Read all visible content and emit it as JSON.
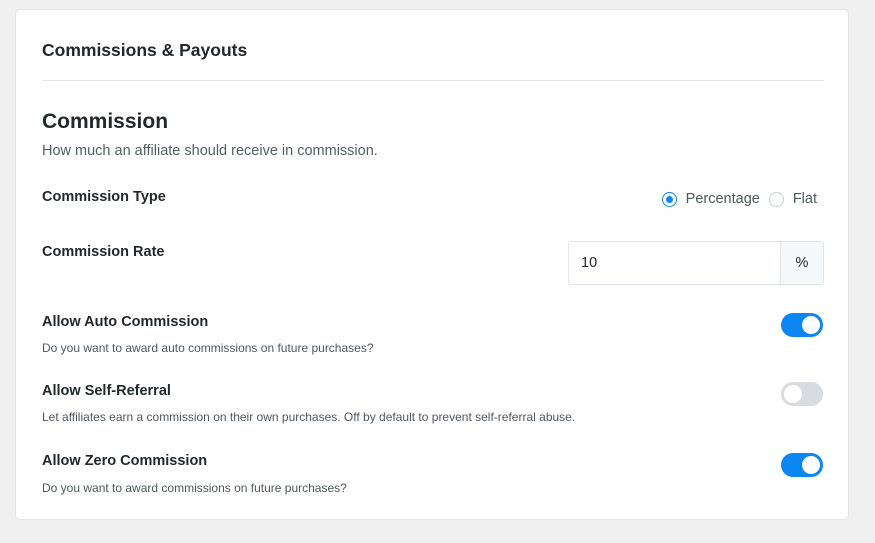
{
  "card": {
    "title": "Commissions & Payouts"
  },
  "commission": {
    "title": "Commission",
    "description": "How much an affiliate should receive in commission.",
    "type": {
      "label": "Commission Type",
      "options": [
        {
          "label": "Percentage",
          "selected": true
        },
        {
          "label": "Flat",
          "selected": false
        }
      ]
    },
    "rate": {
      "label": "Commission Rate",
      "value": "10",
      "suffix": "%"
    },
    "toggles": [
      {
        "label": "Allow Auto Commission",
        "help": "Do you want to award auto commissions on future purchases?",
        "enabled": true
      },
      {
        "label": "Allow Self-Referral",
        "help": "Let affiliates earn a commission on their own purchases. Off by default to prevent self-referral abuse.",
        "enabled": false
      },
      {
        "label": "Allow Zero Commission",
        "help": "Do you want to award commissions on future purchases?",
        "enabled": true
      }
    ]
  },
  "colors": {
    "accent": "#0b86f2",
    "toggle_off": "#d8dbe0",
    "page_background": "#f0f0f1"
  }
}
